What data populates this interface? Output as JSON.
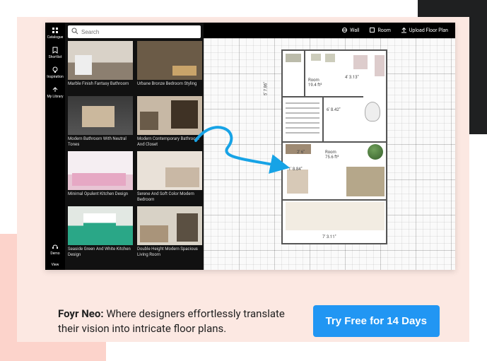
{
  "search": {
    "placeholder": "Search"
  },
  "rail": {
    "items": [
      {
        "label": "Catalogue"
      },
      {
        "label": "Shortlist"
      },
      {
        "label": "Inspiration"
      },
      {
        "label": "My Library"
      }
    ],
    "bottom": [
      {
        "label": "Demo"
      },
      {
        "label": "View"
      }
    ]
  },
  "topbar": {
    "wall": "Wall",
    "room": "Room",
    "upload": "Upload Floor Plan"
  },
  "catalogue": {
    "items": [
      {
        "title": "Marble Finish Fantasy Bathroom"
      },
      {
        "title": "Urbane Bronze Bedroom Styling"
      },
      {
        "title": "Modern Bathroom With Neutral Tones"
      },
      {
        "title": "Modern Contemporary Bathroom And Closet"
      },
      {
        "title": "Minimal Opulent Kitchen Design"
      },
      {
        "title": "Serene And Soft Color Modern Bedroom"
      },
      {
        "title": "Seaside Green And White Kitchen Design"
      },
      {
        "title": "Double Height Modern Spacious Living Room"
      }
    ]
  },
  "floorplan": {
    "room1": {
      "name": "Room",
      "area": "19.4 ft²"
    },
    "room2": {
      "name": "Room",
      "area": "75.6 ft²"
    },
    "dims": {
      "a": "4' 3.13\"",
      "b": "6' 8.42\"",
      "c": "2' 6\"",
      "d": "1' 8.84\"",
      "e": "7' 3.11\"",
      "f": "5' 7.86\""
    }
  },
  "promo": {
    "brand": "Foyr Neo:",
    "text": " Where designers effortlessly translate their vision into intricate floor plans.",
    "cta": "Try Free for 14 Days"
  }
}
